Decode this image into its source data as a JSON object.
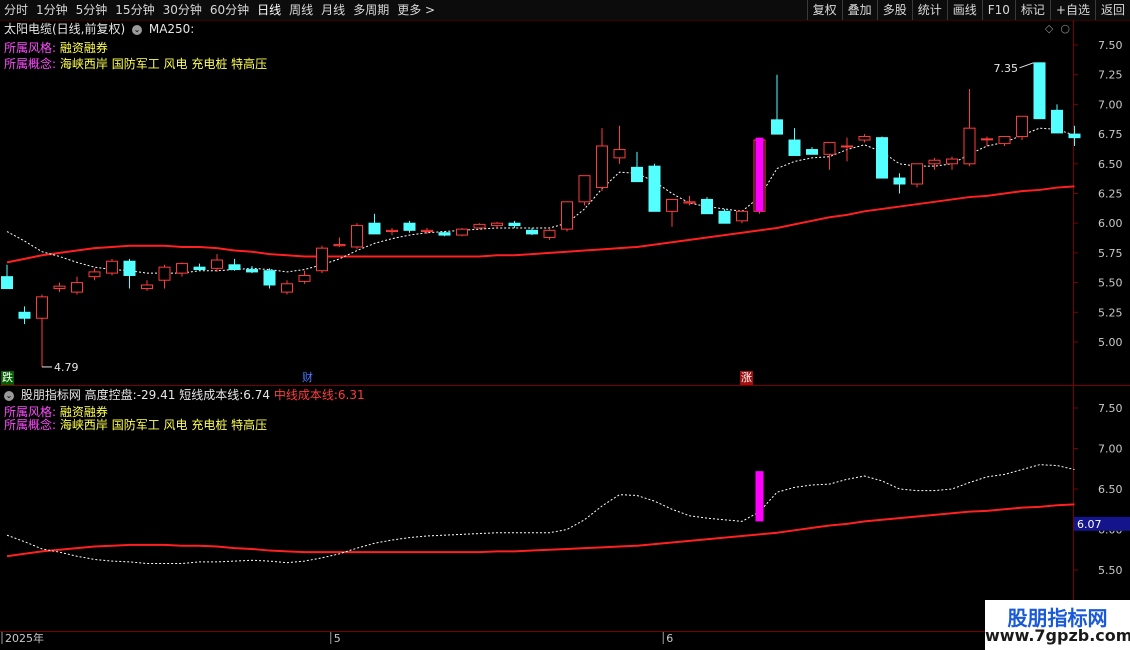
{
  "toolbar": {
    "left_items": [
      "分时",
      "1分钟",
      "5分钟",
      "15分钟",
      "30分钟",
      "60分钟",
      "日线",
      "周线",
      "月线",
      "多周期",
      "更多 >"
    ],
    "active": "日线",
    "right_items": [
      "复权",
      "叠加",
      "多股",
      "统计",
      "画线",
      "F10",
      "标记",
      "+自选",
      "返回"
    ]
  },
  "main_panel": {
    "stock_name": "太阳电缆(日线,前复权)",
    "indicator": "MA250:",
    "style_label": "所属风格:",
    "style_value": "融资融券",
    "concept_label": "所属概念:",
    "concept_value": "海峡西岸 国防军工 风电 充电桩 特高压",
    "price_axis": [
      "7.50",
      "7.25",
      "7.00",
      "6.75",
      "6.50",
      "6.25",
      "6.00",
      "5.75",
      "5.50",
      "5.25",
      "5.00"
    ],
    "high_label": "7.35",
    "low_label": "4.79",
    "events": [
      {
        "text": "跌",
        "color": "#00b000"
      },
      {
        "text": "财",
        "color": "#2a5ad8"
      },
      {
        "text": "涨",
        "color": "#e02020"
      }
    ]
  },
  "sub_panel": {
    "title": "股朋指标网",
    "metric1_label": "高度控盘:",
    "metric1_value": "-29.41",
    "metric2_label": "短线成本线:",
    "metric2_value": "6.74",
    "metric3_label": "中线成本线:",
    "metric3_value": "6.31",
    "style_label": "所属风格:",
    "style_value": "融资融券",
    "concept_label": "所属概念:",
    "concept_value": "海峡西岸 国防军工 风电 充电桩 特高压",
    "axis": [
      "7.50",
      "7.00",
      "6.50",
      "6.00",
      "5.50"
    ],
    "current_value": "6.07"
  },
  "date_axis": [
    "2025年",
    "5",
    "6"
  ],
  "watermark": {
    "title": "股朋指标网",
    "url": "www.7gpzb.com"
  },
  "colors": {
    "up": "#ff3c3c",
    "down": "#54ffff",
    "ma250": "#ff2020",
    "short_line": "#ffffff",
    "signal": "#ff00ff",
    "bg": "#000000"
  },
  "chart_data": {
    "type": "candlestick",
    "ohlc": [
      [
        5.55,
        5.65,
        5.45,
        5.45
      ],
      [
        5.25,
        5.3,
        5.15,
        5.2
      ],
      [
        5.2,
        5.4,
        4.79,
        5.38
      ],
      [
        5.45,
        5.5,
        5.42,
        5.47
      ],
      [
        5.42,
        5.55,
        5.4,
        5.5
      ],
      [
        5.55,
        5.62,
        5.52,
        5.59
      ],
      [
        5.58,
        5.7,
        5.56,
        5.68
      ],
      [
        5.68,
        5.7,
        5.45,
        5.56
      ],
      [
        5.45,
        5.52,
        5.43,
        5.48
      ],
      [
        5.52,
        5.65,
        5.45,
        5.63
      ],
      [
        5.58,
        5.67,
        5.55,
        5.66
      ],
      [
        5.63,
        5.66,
        5.6,
        5.61
      ],
      [
        5.62,
        5.74,
        5.59,
        5.69
      ],
      [
        5.65,
        5.7,
        5.6,
        5.61
      ],
      [
        5.61,
        5.64,
        5.58,
        5.59
      ],
      [
        5.6,
        5.62,
        5.45,
        5.48
      ],
      [
        5.42,
        5.52,
        5.4,
        5.49
      ],
      [
        5.51,
        5.6,
        5.49,
        5.56
      ],
      [
        5.6,
        5.81,
        5.58,
        5.79
      ],
      [
        5.81,
        5.88,
        5.8,
        5.82
      ],
      [
        5.8,
        6.0,
        5.78,
        5.98
      ],
      [
        6.0,
        6.08,
        5.96,
        5.91
      ],
      [
        5.93,
        5.96,
        5.9,
        5.94
      ],
      [
        6.0,
        6.02,
        5.92,
        5.94
      ],
      [
        5.93,
        5.96,
        5.91,
        5.94
      ],
      [
        5.92,
        5.93,
        5.89,
        5.9
      ],
      [
        5.9,
        5.96,
        5.89,
        5.95
      ],
      [
        5.96,
        6.0,
        5.95,
        5.99
      ],
      [
        5.98,
        6.01,
        5.96,
        6.0
      ],
      [
        6.0,
        6.02,
        5.96,
        5.98
      ],
      [
        5.94,
        5.96,
        5.9,
        5.91
      ],
      [
        5.88,
        5.95,
        5.86,
        5.94
      ],
      [
        5.95,
        6.1,
        5.93,
        6.18
      ],
      [
        6.18,
        6.4,
        6.15,
        6.4
      ],
      [
        6.3,
        6.8,
        6.27,
        6.65
      ],
      [
        6.55,
        6.82,
        6.5,
        6.62
      ],
      [
        6.47,
        6.6,
        6.35,
        6.35
      ],
      [
        6.48,
        6.5,
        6.1,
        6.1
      ],
      [
        6.1,
        6.2,
        5.97,
        6.2
      ],
      [
        6.17,
        6.23,
        6.15,
        6.18
      ],
      [
        6.2,
        6.22,
        6.08,
        6.08
      ],
      [
        6.1,
        6.12,
        6.0,
        6.0
      ],
      [
        6.02,
        6.1,
        6.0,
        6.1
      ],
      [
        6.1,
        6.72,
        6.08,
        6.7
      ],
      [
        6.87,
        7.25,
        6.75,
        6.75
      ],
      [
        6.7,
        6.8,
        6.57,
        6.57
      ],
      [
        6.62,
        6.64,
        6.58,
        6.58
      ],
      [
        6.58,
        6.68,
        6.45,
        6.68
      ],
      [
        6.65,
        6.72,
        6.52,
        6.65
      ],
      [
        6.7,
        6.75,
        6.68,
        6.73
      ],
      [
        6.72,
        6.73,
        6.38,
        6.38
      ],
      [
        6.38,
        6.42,
        6.25,
        6.33
      ],
      [
        6.33,
        6.5,
        6.3,
        6.5
      ],
      [
        6.5,
        6.55,
        6.45,
        6.53
      ],
      [
        6.5,
        6.56,
        6.45,
        6.54
      ],
      [
        6.5,
        7.13,
        6.48,
        6.8
      ],
      [
        6.71,
        6.73,
        6.65,
        6.71
      ],
      [
        6.67,
        6.73,
        6.65,
        6.73
      ],
      [
        6.73,
        6.9,
        6.7,
        6.9
      ],
      [
        7.35,
        7.35,
        6.88,
        6.88
      ],
      [
        6.95,
        7.0,
        6.76,
        6.76
      ],
      [
        6.75,
        6.82,
        6.65,
        6.72
      ]
    ],
    "ma_short": [
      5.93,
      5.85,
      5.76,
      5.72,
      5.67,
      5.63,
      5.61,
      5.6,
      5.58,
      5.58,
      5.58,
      5.6,
      5.6,
      5.61,
      5.62,
      5.61,
      5.59,
      5.61,
      5.65,
      5.7,
      5.77,
      5.83,
      5.87,
      5.9,
      5.92,
      5.93,
      5.94,
      5.95,
      5.96,
      5.96,
      5.96,
      5.96,
      6.0,
      6.12,
      6.29,
      6.43,
      6.42,
      6.35,
      6.25,
      6.17,
      6.14,
      6.12,
      6.1,
      6.22,
      6.46,
      6.52,
      6.55,
      6.56,
      6.62,
      6.66,
      6.6,
      6.5,
      6.48,
      6.48,
      6.5,
      6.58,
      6.65,
      6.68,
      6.74,
      6.8,
      6.79,
      6.74
    ],
    "ma250": [
      5.67,
      5.7,
      5.73,
      5.75,
      5.77,
      5.79,
      5.8,
      5.81,
      5.81,
      5.81,
      5.8,
      5.8,
      5.79,
      5.77,
      5.76,
      5.74,
      5.73,
      5.72,
      5.72,
      5.72,
      5.72,
      5.72,
      5.72,
      5.72,
      5.72,
      5.72,
      5.72,
      5.72,
      5.73,
      5.73,
      5.74,
      5.75,
      5.76,
      5.77,
      5.78,
      5.79,
      5.8,
      5.82,
      5.84,
      5.86,
      5.88,
      5.9,
      5.92,
      5.94,
      5.96,
      5.99,
      6.02,
      6.05,
      6.07,
      6.1,
      6.12,
      6.14,
      6.16,
      6.18,
      6.2,
      6.22,
      6.23,
      6.25,
      6.27,
      6.28,
      6.3,
      6.31
    ],
    "signals": [
      {
        "index": 43,
        "from": 6.1,
        "to": 6.72
      }
    ],
    "price_range": [
      4.79,
      7.55
    ]
  }
}
